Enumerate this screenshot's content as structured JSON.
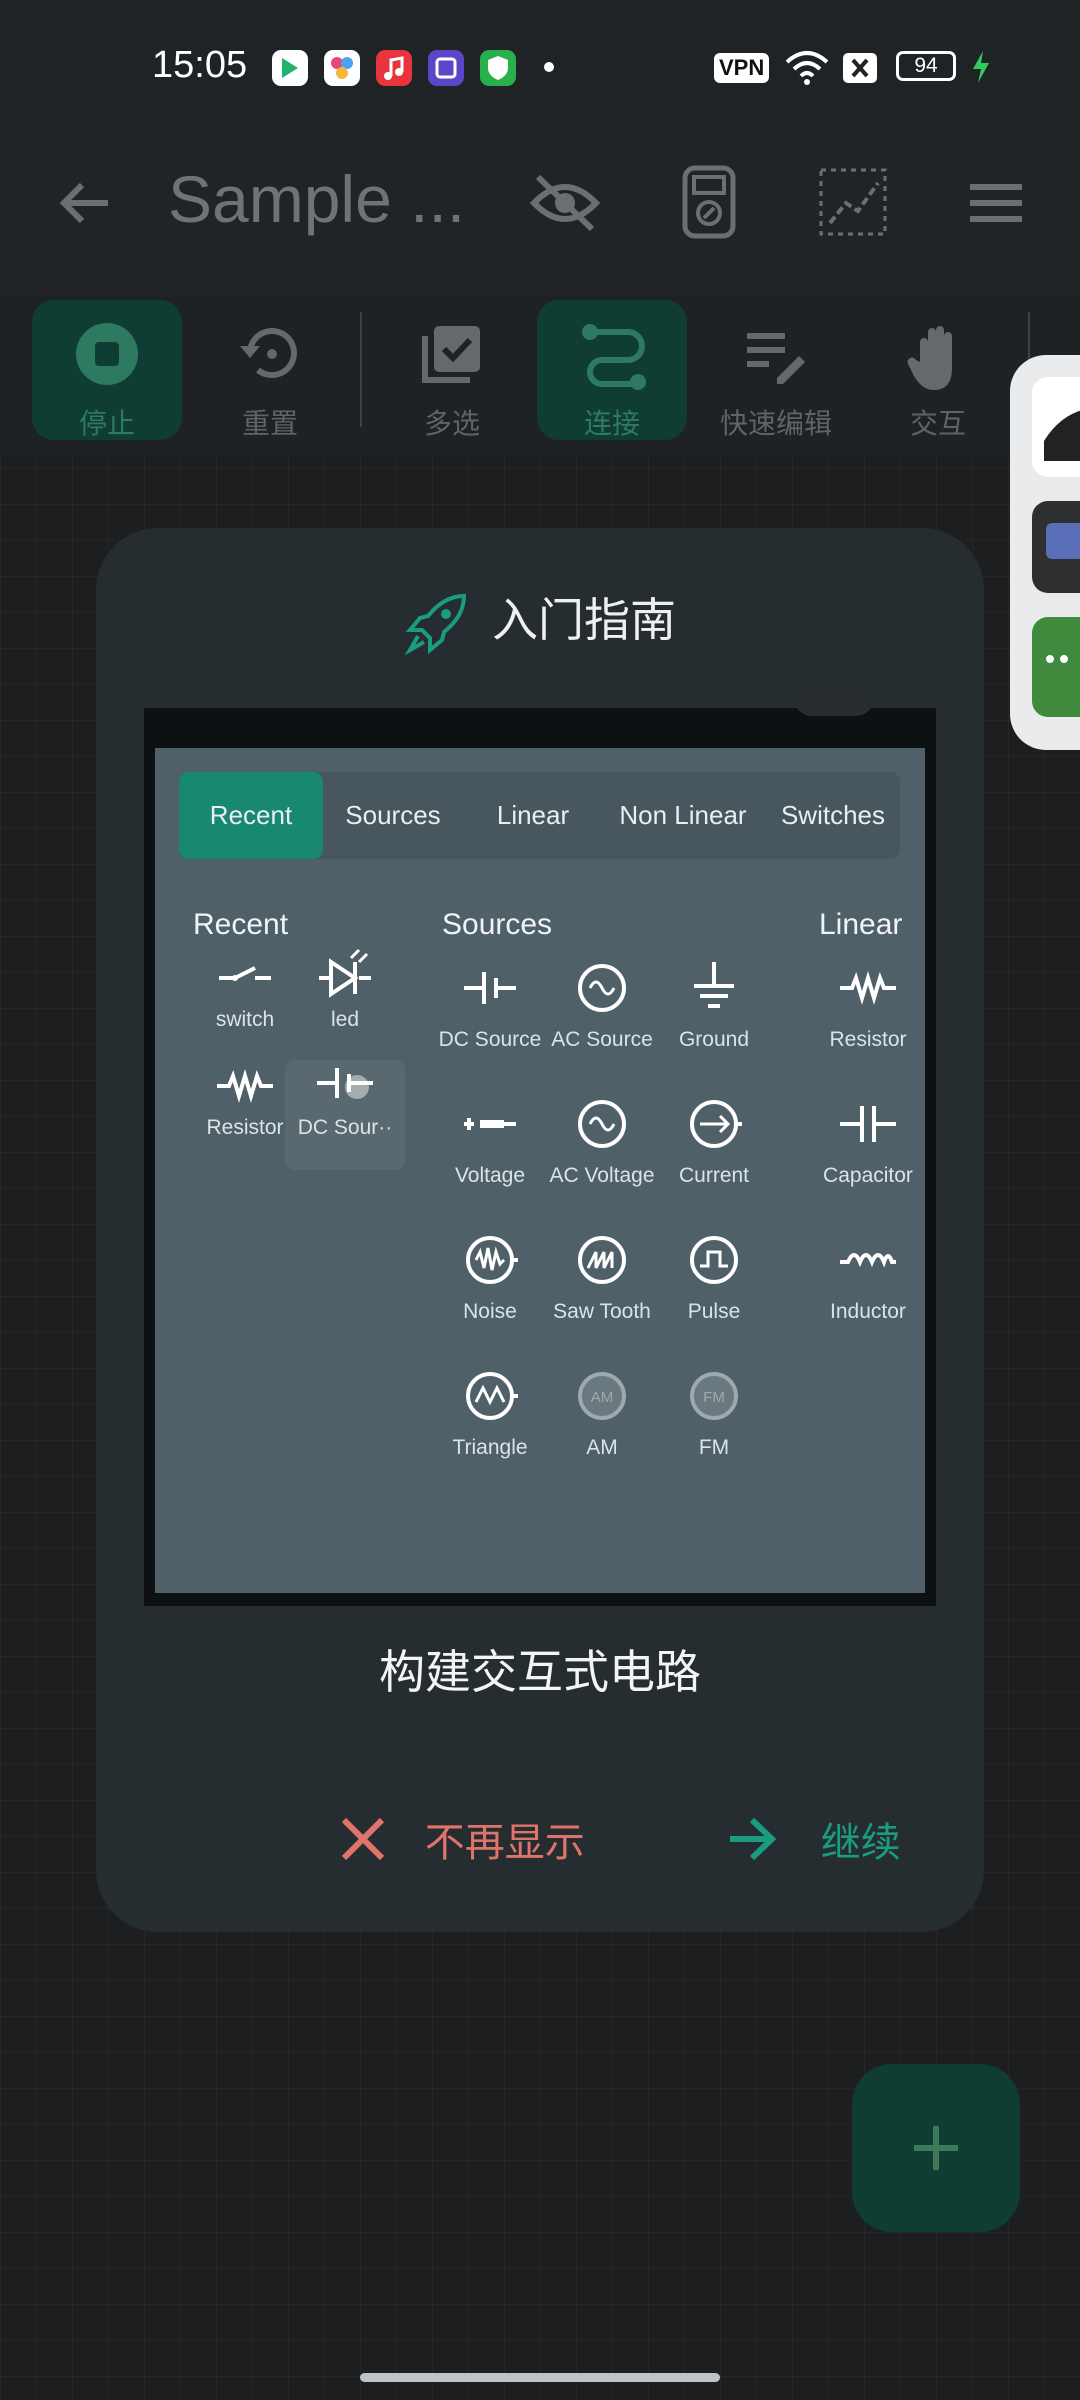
{
  "status_bar": {
    "time": "15:05",
    "vpn": "VPN",
    "battery": "94"
  },
  "app_bar": {
    "title": "Sample ..."
  },
  "toolbar": {
    "stop": "停止",
    "reset": "重置",
    "multiselect": "多选",
    "connect": "连接",
    "quick_edit": "快速编辑",
    "interact": "交互"
  },
  "dialog": {
    "title": "入门指南",
    "caption": "构建交互式电路",
    "dismiss": "不再显示",
    "continue": "继续",
    "video": {
      "tabs": [
        "Recent",
        "Sources",
        "Linear",
        "Non Linear",
        "Switches"
      ],
      "sections": {
        "recent": "Recent",
        "sources": "Sources",
        "linear": "Linear"
      },
      "recent_items": [
        "switch",
        "led",
        "Resistor",
        "DC Sour··"
      ],
      "source_items": [
        "DC Source",
        "AC Source",
        "Ground",
        "Voltage",
        "AC Voltage",
        "Current",
        "Noise",
        "Saw Tooth",
        "Pulse",
        "Triangle",
        "AM",
        "FM"
      ],
      "linear_items": [
        "Resistor",
        "Capacitor",
        "Inductor"
      ]
    }
  },
  "colors": {
    "accent": "#1a9c80",
    "dismiss": "#e0736a",
    "active_tool_bg": "#0f3d33",
    "dialog_bg": "#262d31"
  }
}
